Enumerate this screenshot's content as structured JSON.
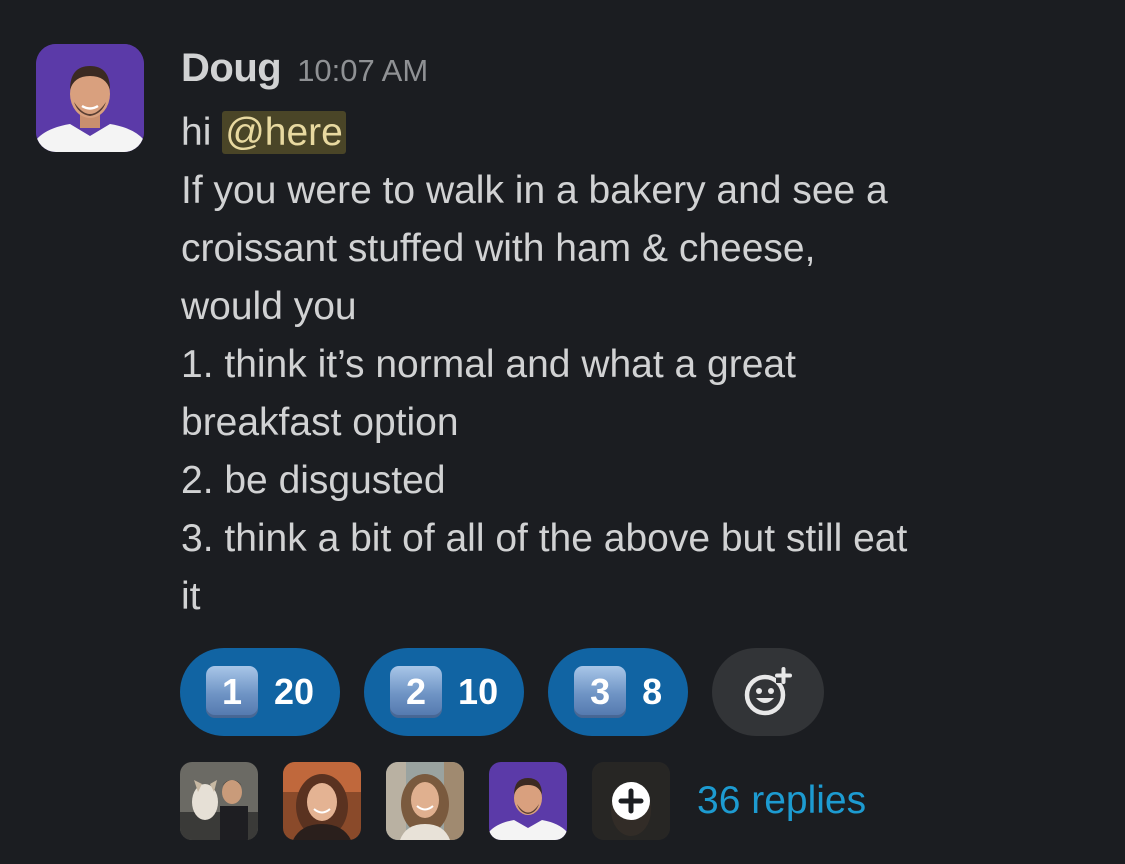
{
  "message": {
    "author": "Doug",
    "timestamp": "10:07 AM",
    "greeting": "hi",
    "mention": "@here",
    "lines": [
      "If you were to walk in a bakery and see a",
      "croissant stuffed with ham & cheese,",
      "would you",
      "1. think it’s normal and what a great",
      "breakfast option",
      "2. be disgusted",
      "3. think a bit of all of the above but still eat",
      "it"
    ]
  },
  "reactions": [
    {
      "emoji": "1",
      "count": "20"
    },
    {
      "emoji": "2",
      "count": "10"
    },
    {
      "emoji": "3",
      "count": "8"
    }
  ],
  "add_reaction_icon": "add-emoji-icon",
  "thread": {
    "replies": "36 replies"
  },
  "colors": {
    "background": "#1b1d21",
    "reaction_bg": "#1164a3",
    "link": "#1d9bd1",
    "mention_bg": "#4a4527"
  }
}
